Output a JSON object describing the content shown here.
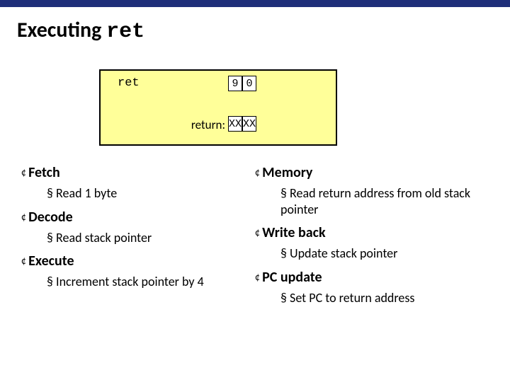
{
  "title_prefix": "Executing ",
  "title_code": "ret",
  "diagram": {
    "mnemonic": "ret",
    "return_label": "return:",
    "cells_top": [
      "9",
      "0"
    ],
    "cells_bottom": [
      "XX",
      "XX"
    ]
  },
  "left": [
    {
      "stage": "Fetch",
      "items": [
        "Read 1 byte"
      ]
    },
    {
      "stage": "Decode",
      "items": [
        "Read stack pointer"
      ]
    },
    {
      "stage": "Execute",
      "items": [
        "Increment stack pointer by 4"
      ]
    }
  ],
  "right": [
    {
      "stage": "Memory",
      "items": [
        "Read return address from old stack pointer"
      ]
    },
    {
      "stage": "Write back",
      "items": [
        "Update stack pointer"
      ]
    },
    {
      "stage": "PC update",
      "items": [
        "Set PC to return address"
      ]
    }
  ]
}
